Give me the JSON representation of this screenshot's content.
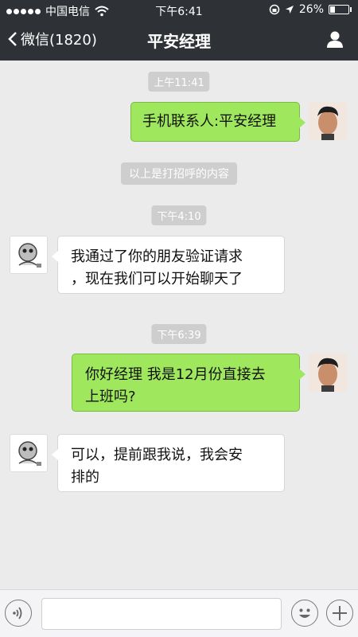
{
  "status_bar": {
    "carrier": "中国电信",
    "time": "下午6:41",
    "battery": "26%"
  },
  "nav": {
    "back_label": "微信(1820)",
    "title": "平安经理"
  },
  "messages": [
    {
      "type": "timestamp",
      "text": "上午11:41"
    },
    {
      "type": "message",
      "sender": "me",
      "text": "手机联系人:平安经理"
    },
    {
      "type": "system",
      "text": "以上是打招呼的内容"
    },
    {
      "type": "timestamp",
      "text": "下午4:10"
    },
    {
      "type": "message",
      "sender": "other",
      "lines": [
        "我通过了你的朋友验证请求",
        "，现在我们可以开始聊天了"
      ]
    },
    {
      "type": "timestamp",
      "text": "下午6:39"
    },
    {
      "type": "message",
      "sender": "me",
      "lines": [
        "你好经理 我是12月份直接去",
        "上班吗?"
      ]
    },
    {
      "type": "message",
      "sender": "other",
      "lines": [
        "可以，提前跟我说，我会安",
        "排的"
      ]
    }
  ],
  "input": {
    "value": "",
    "placeholder": ""
  },
  "icons": {
    "back": "chevron-left-icon",
    "profile": "person-icon",
    "voice": "voice-icon",
    "emoji": "emoji-icon",
    "more": "plus-icon",
    "wifi": "wifi-icon",
    "location": "location-arrow-icon",
    "lock": "rotation-lock-icon"
  },
  "colors": {
    "header_bg": "#2e3136",
    "chat_bg": "#ebebeb",
    "my_bubble": "#9fe75d",
    "other_bubble": "#ffffff",
    "timestamp_bg": "#cecece"
  }
}
